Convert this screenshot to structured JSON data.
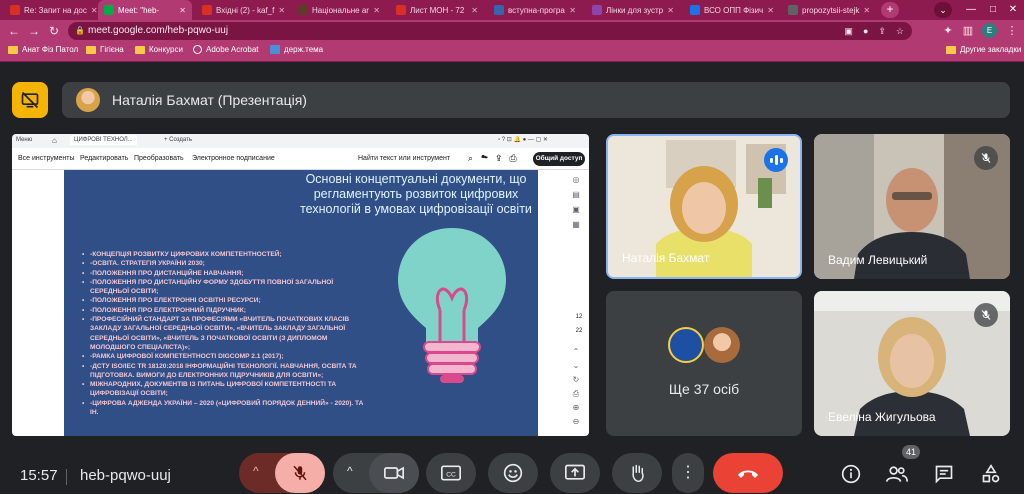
{
  "browser": {
    "tabs": [
      {
        "label": "Re: Запит на дос",
        "color": "#d93025",
        "active": false
      },
      {
        "label": "Meet: \"heb-",
        "color": "#00ac47",
        "active": true
      },
      {
        "label": "Вхідні (2) - kaf_f",
        "color": "#d93025",
        "active": false
      },
      {
        "label": "Національне ar",
        "color": "#5f3b2c",
        "active": false
      },
      {
        "label": "Лист МОН - 72",
        "color": "#d93025",
        "active": false
      },
      {
        "label": "вступна-програ",
        "color": "#3366aa",
        "active": false
      },
      {
        "label": "Лінки для зустр",
        "color": "#8e44ad",
        "active": false
      },
      {
        "label": "ВСО ОПП Фізич",
        "color": "#1a73e8",
        "active": false
      },
      {
        "label": "propozytsii-stejk",
        "color": "#5f6368",
        "active": false
      }
    ],
    "new_tab": "+",
    "tab_dropdown": "⌄",
    "window_controls": [
      "—",
      "□",
      "✕"
    ],
    "url": "meet.google.com/heb-pqwo-uuj",
    "profile_letter": "E",
    "bookmarks": [
      {
        "label": "Анат Фіз Патол",
        "icon": "folder-icon"
      },
      {
        "label": "Гігієна",
        "icon": "folder-icon"
      },
      {
        "label": "Конкурси",
        "icon": "folder-icon"
      },
      {
        "label": "Adobe Acrobat",
        "icon": "globe-icon"
      },
      {
        "label": "держ.тема",
        "icon": "folder-icon"
      }
    ],
    "other_bookmarks": "Другие закладки"
  },
  "meet": {
    "presenter_label": "Наталія Бахмат (Презентація)",
    "shared_screen": {
      "pdf_top": {
        "menu": "Меню",
        "home": "⌂",
        "file_tab": "ЦИФРОВІ ТЕХНОЛ...",
        "create": "+ Создать"
      },
      "pdf_toolbar": {
        "items": [
          "Все инструменты",
          "Редактировать",
          "Преобразовать",
          "Электронное подписание"
        ],
        "search": "Найти текст или инструмент",
        "share_button": "Общий доступ"
      },
      "page_numbers": [
        "12",
        "22"
      ],
      "slide": {
        "title": "Основні концептуальні документи, що регламентують розвиток цифрових технологій в умовах цифровізації освіти",
        "items": [
          "-КОНЦЕПЦІЯ РОЗВИТКУ ЦИФРОВИХ КОМПЕТЕНТНОСТЕЙ;",
          "-ОСВІТА. СТРАТЕГІЯ УКРАЇНИ 2030;",
          "-ПОЛОЖЕННЯ ПРО ДИСТАНЦІЙНЕ НАВЧАННЯ;",
          "-ПОЛОЖЕННЯ ПРО ДИСТАНЦІЙНУ ФОРМУ ЗДОБУТТЯ ПОВНОЇ ЗАГАЛЬНОЇ СЕРЕДНЬОЇ ОСВІТИ;",
          "-ПОЛОЖЕННЯ ПРО ЕЛЕКТРОННІ ОСВІТНІ РЕСУРСИ;",
          "-ПОЛОЖЕННЯ ПРО ЕЛЕКТРОННИЙ ПІДРУЧНИК;",
          "-ПРОФЕСІЙНИЙ СТАНДАРТ ЗА ПРОФЕСІЯМИ «ВЧИТЕЛЬ ПОЧАТКОВИХ КЛАСІВ ЗАКЛАДУ ЗАГАЛЬНОЇ СЕРЕДНЬОЇ ОСВІТИ», «ВЧИТЕЛЬ ЗАКЛАДУ ЗАГАЛЬНОЇ СЕРЕДНЬОЇ ОСВІТИ», «ВЧИТЕЛЬ З ПОЧАТКОВОЇ ОСВІТИ (З ДИПЛОМОМ МОЛОДШОГО СПЕЦІАЛІСТА)»;",
          "-РАМКА ЦИФРОВОЇ КОМПЕТЕНТНОСТІ DIGCOMP 2.1 (2017);",
          "-ДСТУ ISO/IEC TR 18120:2018 ІНФОРМАЦІЙНІ ТЕХНОЛОГІЇ. НАВЧАННЯ, ОСВІТА ТА ПІДГОТОВКА. ВИМОГИ ДО ЕЛЕКТРОННИХ ПІДРУЧНИКІВ ДЛЯ ОСВІТИ»;",
          "МІЖНАРОДНИХ, ДОКУМЕНТІВ ІЗ ПИТАНЬ ЦИФРОВОЇ КОМПЕТЕНТНОСТІ ТА ЦИФРОВІЗАЦІЇ ОСВІТИ;",
          "-ЦИФРОВА АДЖЕНДА УКРАЇНИ – 2020 («ЦИФРОВИЙ ПОРЯДОК ДЕННИЙ» - 2020). ТА ІН."
        ]
      }
    },
    "participants": {
      "active_speaker": "Наталія Бахмат",
      "p2": "Вадим Левицький",
      "others": "Ще 37 осіб",
      "p3": "Евеліна Жигульова"
    },
    "bottom": {
      "time": "15:57",
      "meeting_code": "heb-pqwo-uuj",
      "people_count": "41"
    }
  },
  "colors": {
    "accent_yellow": "#f4b400",
    "end_call_red": "#ea4335",
    "speaking_blue": "#1a73e8",
    "browser_magenta": "#b23a72"
  }
}
